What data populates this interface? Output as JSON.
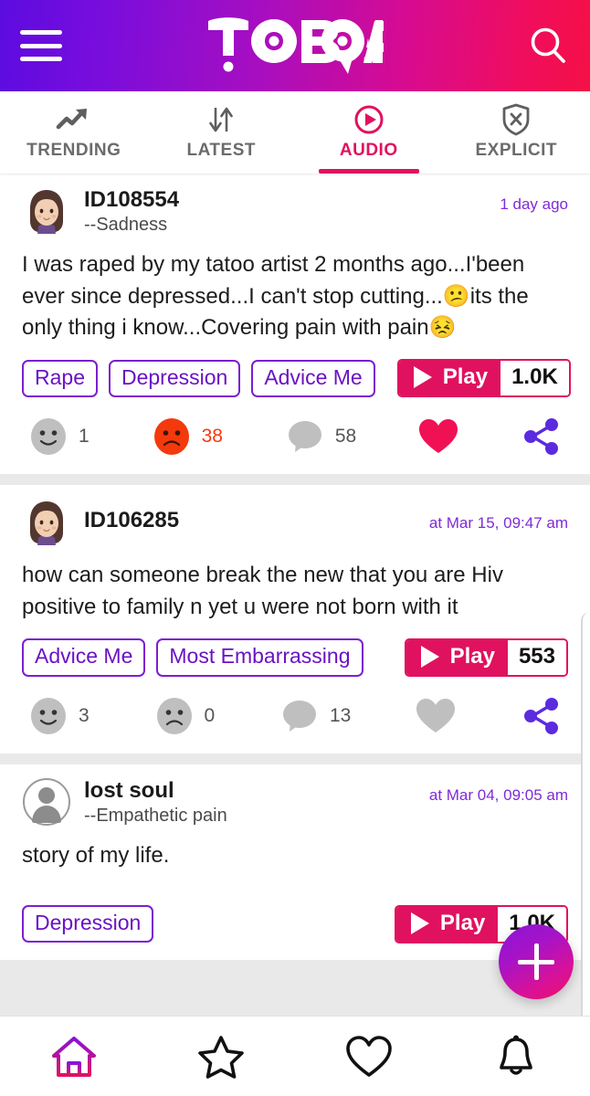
{
  "app": {
    "title": "TOBOA",
    "menu_label": "Menu",
    "search_label": "Search"
  },
  "theme": {
    "gradient_start": "#5C0CE0",
    "gradient_end": "#F51046",
    "accent_pink": "#E0125F",
    "accent_purple": "#6A12C4",
    "sad_orange": "#F4390D",
    "muted_gray": "#BDBDBD"
  },
  "tabs": [
    {
      "label": "TRENDING",
      "icon": "trending-up-icon",
      "active": false
    },
    {
      "label": "LATEST",
      "icon": "sort-arrows-icon",
      "active": false
    },
    {
      "label": "AUDIO",
      "icon": "play-circle-icon",
      "active": true
    },
    {
      "label": "EXPLICIT",
      "icon": "shield-x-icon",
      "active": false
    }
  ],
  "posts": [
    {
      "username": "ID108554",
      "mood": "--Sadness",
      "timestamp": "1 day ago",
      "avatar": "female-avatar",
      "text": "I was raped by my tatoo artist 2 months ago...I'been ever since depressed...I can't stop cutting...😕its the only thing i know...Covering pain with pain😣",
      "tags": [
        "Rape",
        "Depression",
        "Advice Me"
      ],
      "play_label": "Play",
      "play_count": "1.0K",
      "smile_count": "1",
      "sad_count": "38",
      "comment_count": "58",
      "sad_active": true,
      "liked": true
    },
    {
      "username": "ID106285",
      "mood": "",
      "timestamp": "at Mar 15, 09:47 am",
      "avatar": "female-avatar",
      "text": "how can someone break the new that you are Hiv positive to family n yet u were not born with it",
      "tags": [
        "Advice Me",
        "Most Embarrassing"
      ],
      "play_label": "Play",
      "play_count": "553",
      "smile_count": "3",
      "sad_count": "0",
      "comment_count": "13",
      "sad_active": false,
      "liked": false
    },
    {
      "username": "lost soul",
      "mood": "--Empathetic pain",
      "timestamp": "at Mar 04, 09:05 am",
      "avatar": "default-avatar",
      "text": "story of my life.",
      "tags": [
        "Depression"
      ],
      "play_label": "Play",
      "play_count": "1.0K",
      "smile_count": "",
      "sad_count": "",
      "comment_count": "",
      "sad_active": false,
      "liked": false
    }
  ],
  "fab": {
    "label": "+",
    "name": "create-post-button"
  },
  "bottom_nav": [
    {
      "name": "nav-home",
      "icon": "home-icon",
      "active": true
    },
    {
      "name": "nav-favorites",
      "icon": "star-icon",
      "active": false
    },
    {
      "name": "nav-likes",
      "icon": "heart-icon",
      "active": false
    },
    {
      "name": "nav-notifications",
      "icon": "bell-icon",
      "active": false
    }
  ]
}
